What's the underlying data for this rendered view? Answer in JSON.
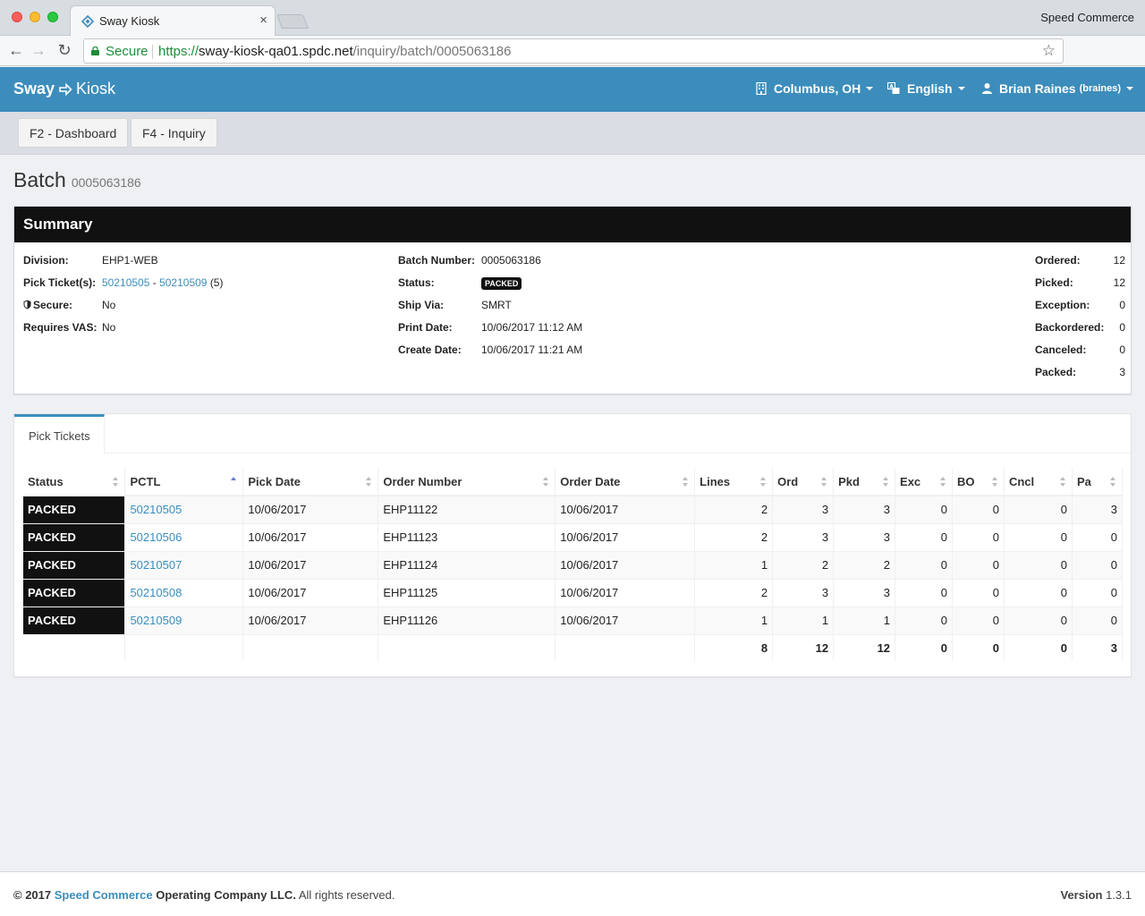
{
  "browser": {
    "tab_title": "Sway Kiosk",
    "tab_close": "×",
    "profile": "Speed Commerce",
    "secure": "Secure",
    "url_scheme": "https://",
    "url_host": "sway-kiosk-qa01.spdc.net",
    "url_path": "/inquiry/batch/0005063186"
  },
  "header": {
    "brand_left": "Sway",
    "brand_right": "Kiosk",
    "location": "Columbus, OH",
    "language": "English",
    "user_name": "Brian Raines",
    "user_login": "(braines)",
    "color": "#3c8dbc"
  },
  "toolbar": {
    "dashboard": "F2 - Dashboard",
    "inquiry": "F4 - Inquiry"
  },
  "page": {
    "title": "Batch",
    "subtitle": "0005063186"
  },
  "summary": {
    "heading": "Summary",
    "division_label": "Division:",
    "division": "EHP1-WEB",
    "pick_tickets_label": "Pick Ticket(s):",
    "pick_first": "50210505",
    "pick_dash": "-",
    "pick_last": "50210509",
    "pick_count": "(5)",
    "secure_label": "Secure:",
    "secure": "No",
    "vas_label": "Requires VAS:",
    "vas": "No",
    "batch_label": "Batch Number:",
    "batch": "0005063186",
    "status_label": "Status:",
    "status": "PACKED",
    "shipvia_label": "Ship Via:",
    "shipvia": "SMRT",
    "print_label": "Print Date:",
    "print": "10/06/2017 11:12 AM",
    "create_label": "Create Date:",
    "create": "10/06/2017 11:21 AM",
    "ordered_label": "Ordered:",
    "ordered": "12",
    "picked_label": "Picked:",
    "picked": "12",
    "exception_label": "Exception:",
    "exception": "0",
    "backordered_label": "Backordered:",
    "backordered": "0",
    "canceled_label": "Canceled:",
    "canceled": "0",
    "packed_label": "Packed:",
    "packed": "3"
  },
  "tabs": {
    "pick_tickets": "Pick Tickets"
  },
  "table": {
    "columns": [
      "Status",
      "PCTL",
      "Pick Date",
      "Order Number",
      "Order Date",
      "Lines",
      "Ord",
      "Pkd",
      "Exc",
      "BO",
      "Cncl",
      "Pa"
    ],
    "rows": [
      [
        "PACKED",
        "50210505",
        "10/06/2017",
        "EHP11122",
        "10/06/2017",
        "2",
        "3",
        "3",
        "0",
        "0",
        "0",
        "3"
      ],
      [
        "PACKED",
        "50210506",
        "10/06/2017",
        "EHP11123",
        "10/06/2017",
        "2",
        "3",
        "3",
        "0",
        "0",
        "0",
        "0"
      ],
      [
        "PACKED",
        "50210507",
        "10/06/2017",
        "EHP11124",
        "10/06/2017",
        "1",
        "2",
        "2",
        "0",
        "0",
        "0",
        "0"
      ],
      [
        "PACKED",
        "50210508",
        "10/06/2017",
        "EHP11125",
        "10/06/2017",
        "2",
        "3",
        "3",
        "0",
        "0",
        "0",
        "0"
      ],
      [
        "PACKED",
        "50210509",
        "10/06/2017",
        "EHP11126",
        "10/06/2017",
        "1",
        "1",
        "1",
        "0",
        "0",
        "0",
        "0"
      ]
    ],
    "totals": [
      "",
      "",
      "",
      "",
      "",
      "8",
      "12",
      "12",
      "0",
      "0",
      "0",
      "3"
    ]
  },
  "footer": {
    "copy": "© 2017",
    "company_link": "Speed Commerce",
    "company_rest": "Operating Company LLC.",
    "rights": "All rights reserved.",
    "version_label": "Version",
    "version": "1.3.1"
  }
}
